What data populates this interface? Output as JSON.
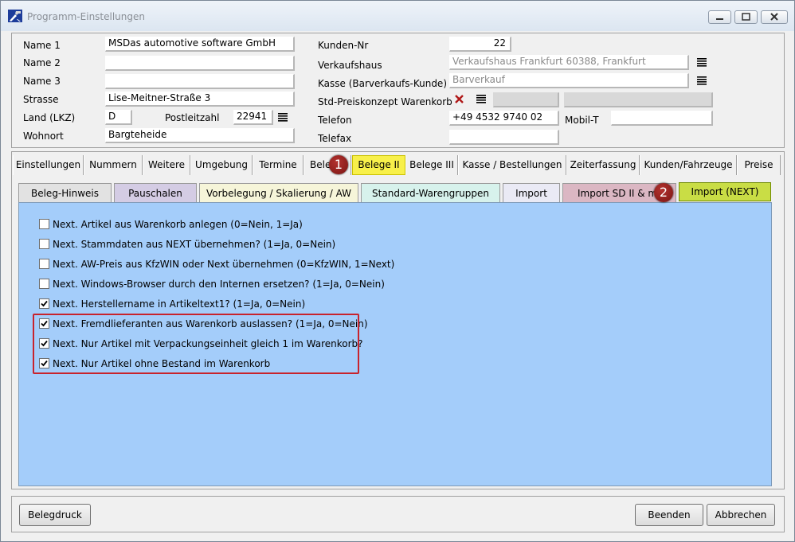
{
  "window": {
    "title": "Programm-Einstellungen"
  },
  "customer": {
    "labels": {
      "name1": "Name 1",
      "name2": "Name 2",
      "name3": "Name 3",
      "strasse": "Strasse",
      "land": "Land (LKZ)",
      "plz": "Postleitzahl",
      "wohnort": "Wohnort"
    },
    "name1": "MSDas automotive software GmbH",
    "name2": "",
    "name3": "",
    "strasse": "Lise-Meitner-Straße 3",
    "land": "D",
    "plz": "22941",
    "wohnort": "Bargteheide"
  },
  "store": {
    "labels": {
      "kunden_nr": "Kunden-Nr",
      "verkaufshaus": "Verkaufshaus",
      "kasse": "Kasse (Barverkaufs-Kunde)",
      "preiskonzept": "Std-Preiskonzept Warenkorb",
      "telefon": "Telefon",
      "mobil": "Mobil-T",
      "telefax": "Telefax"
    },
    "kunden_nr": "22",
    "verkaufshaus": "Verkaufshaus Frankfurt 60388, Frankfurt",
    "kasse": "Barverkauf",
    "telefon": "+49 4532 9740 02",
    "mobil": "",
    "telefax": ""
  },
  "main_tabs": [
    "Einstellungen",
    "Nummern",
    "Weitere",
    "Umgebung",
    "Termine",
    "Bele",
    "Belege II",
    "Belege III",
    "Kasse / Bestellungen",
    "Zeiterfassung",
    "Kunden/Fahrzeuge",
    "Preise"
  ],
  "sub_tabs": [
    "Beleg-Hinweis",
    "Pauschalen",
    "Vorbelegung / Skalierung / AW",
    "Standard-Warengruppen",
    "Import",
    "Import SD II & me",
    "Import (NEXT)"
  ],
  "badges": [
    "1",
    "2"
  ],
  "options": [
    {
      "label": "Next. Artikel aus Warenkorb anlegen (0=Nein, 1=Ja)",
      "checked": false
    },
    {
      "label": "Next. Stammdaten aus NEXT übernehmen? (1=Ja, 0=Nein)",
      "checked": false
    },
    {
      "label": "Next. AW-Preis aus KfzWIN oder Next übernehmen (0=KfzWIN, 1=Next)",
      "checked": false
    },
    {
      "label": "Next. Windows-Browser durch den Internen ersetzen? (1=Ja, 0=Nein)",
      "checked": false
    },
    {
      "label": "Next. Herstellername in Artikeltext1? (1=Ja, 0=Nein)",
      "checked": true
    },
    {
      "label": "Next. Fremdlieferanten aus Warenkorb auslassen? (1=Ja, 0=Nein)",
      "checked": true
    },
    {
      "label": "Next. Nur Artikel mit Verpackungseinheit gleich 1 im Warenkorb?",
      "checked": true
    },
    {
      "label": "Next. Nur Artikel ohne Bestand im Warenkorb",
      "checked": true
    }
  ],
  "buttons": {
    "belegdruck": "Belegdruck",
    "beenden": "Beenden",
    "abbrechen": "Abbrechen"
  },
  "colors": {
    "content_bg": "#a4cdfa",
    "active_main_tab": "#f8f04a",
    "active_sub_tab": "#c9dd45",
    "highlight": "#c8232c"
  }
}
